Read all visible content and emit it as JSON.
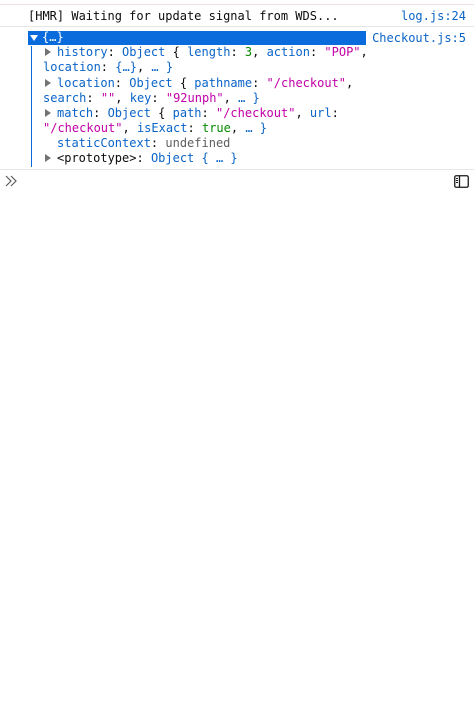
{
  "console": {
    "messages": [
      {
        "text": "[HMR] Waiting for update signal from WDS...",
        "source": "log.js:24"
      }
    ],
    "object_log": {
      "source": "Checkout.js:5",
      "header": "{…}",
      "history": {
        "key": "history",
        "type": "Object",
        "length_label": "length",
        "length_value": "3",
        "action_label": "action",
        "action_value": "\"POP\"",
        "location_label": "location",
        "location_value": "{…}",
        "tail": "… }"
      },
      "location": {
        "key": "location",
        "type": "Object",
        "pathname_label": "pathname",
        "pathname_value": "\"/checkout\"",
        "search_label": "search",
        "search_value": "\"\"",
        "key_label": "key",
        "key_value": "\"92unph\"",
        "tail": "… }"
      },
      "match": {
        "key": "match",
        "type": "Object",
        "path_label": "path",
        "path_value": "\"/checkout\"",
        "url_label": "url",
        "url_value": "\"/checkout\"",
        "isExact_label": "isExact",
        "isExact_value": "true",
        "tail": "… }"
      },
      "staticContext": {
        "key": "staticContext",
        "value": "undefined"
      },
      "prototype": {
        "key": "<prototype>",
        "type": "Object",
        "tail": "{ … }"
      }
    }
  },
  "input": {
    "prompt_icon": "chevron-double-right-icon"
  },
  "toolbar": {
    "sidebar_icon": "sidebar-toggle-icon"
  },
  "colors": {
    "selection": "#0a6cdc",
    "link": "#0a64c8",
    "string": "#c200a8",
    "number": "#058b00"
  }
}
